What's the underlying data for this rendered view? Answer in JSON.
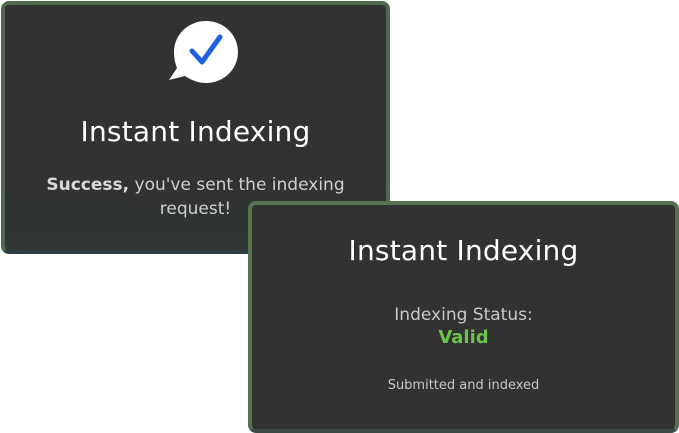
{
  "success_card": {
    "title": "Instant Indexing",
    "message_strong": "Success,",
    "message_rest": " you've sent the indexing request!",
    "icon": "check-bubble-icon"
  },
  "status_card": {
    "title": "Instant Indexing",
    "status_label": "Indexing Status:",
    "status_value": "Valid",
    "status_note": "Submitted and indexed"
  },
  "colors": {
    "card_bg": "#323232",
    "accent_check": "#1f5fe0",
    "status_valid": "#6cc24a",
    "border": "#4f6a4a"
  }
}
